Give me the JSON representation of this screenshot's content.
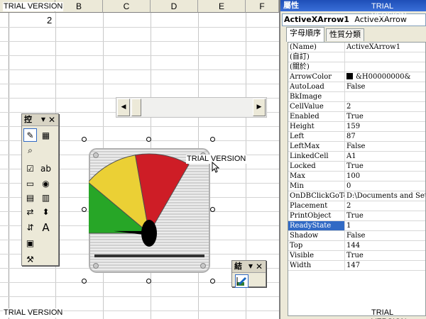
{
  "sheet": {
    "columns": [
      "B",
      "C",
      "D",
      "E",
      "F"
    ],
    "cell_value": "2"
  },
  "watermark": {
    "text": "TRIAL VERSION"
  },
  "toolbox_controls": {
    "title": "控",
    "icons": [
      "design-mode-icon",
      "properties-icon",
      "view-code-icon",
      "checkbox-icon",
      "textbox-icon",
      "command-button-icon",
      "option-button-icon",
      "listbox-icon",
      "combobox-icon",
      "toggle-button-icon",
      "spin-button-icon",
      "scrollbar-icon",
      "label-icon",
      "image-icon",
      "more-controls-icon"
    ]
  },
  "toolbox_exit": {
    "title": "結"
  },
  "gauge": {
    "name": "ActiveXArrow1",
    "value": 2,
    "min": 0,
    "max": 100,
    "colors": {
      "green": "#2bb52b",
      "yellow": "#ffe23a",
      "red": "#e0202a"
    }
  },
  "properties": {
    "title": "屬性",
    "object_name": "ActiveXArrow1",
    "object_type": "ActiveXArrow",
    "tabs": [
      "字母順序",
      "性質分類"
    ],
    "rows": [
      {
        "name": "(Name)",
        "value": "ActiveXArrow1"
      },
      {
        "name": "(自訂)",
        "value": ""
      },
      {
        "name": "(關於)",
        "value": ""
      },
      {
        "name": "ArrowColor",
        "value": "&H00000000&"
      },
      {
        "name": "AutoLoad",
        "value": "False"
      },
      {
        "name": "BkImage",
        "value": ""
      },
      {
        "name": "CellValue",
        "value": "2"
      },
      {
        "name": "Enabled",
        "value": "True"
      },
      {
        "name": "Height",
        "value": "159"
      },
      {
        "name": "Left",
        "value": "87"
      },
      {
        "name": "LeftMax",
        "value": "False"
      },
      {
        "name": "LinkedCell",
        "value": "A1"
      },
      {
        "name": "Locked",
        "value": "True"
      },
      {
        "name": "Max",
        "value": "100"
      },
      {
        "name": "Min",
        "value": "0"
      },
      {
        "name": "OnDBClickGoTo",
        "value": "D:\\Documents and Settings"
      },
      {
        "name": "Placement",
        "value": "2"
      },
      {
        "name": "PrintObject",
        "value": "True"
      },
      {
        "name": "ReadyState",
        "value": "1"
      },
      {
        "name": "Shadow",
        "value": "False"
      },
      {
        "name": "Top",
        "value": "144"
      },
      {
        "name": "Visible",
        "value": "True"
      },
      {
        "name": "Width",
        "value": "147"
      }
    ],
    "selected_row": "ReadyState"
  },
  "colors": {
    "selection": "#316ac5",
    "titlebar": "#1e4fb8"
  }
}
